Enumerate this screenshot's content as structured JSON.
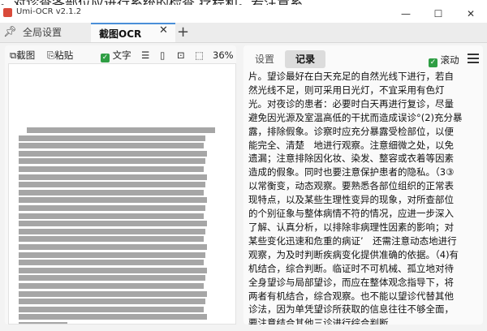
{
  "window": {
    "title": "Umi-OCR v2.1.2",
    "minimize": "—",
    "maximize": "☐",
    "close": "✕"
  },
  "tabs": [
    {
      "label": "全局设置"
    },
    {
      "label": "截图OCR"
    }
  ],
  "tab_close_glyph": "✕",
  "tab_add_glyph": "+",
  "toolbar": {
    "screenshot": "截图",
    "paste": "粘贴",
    "text": "文字",
    "zoom": "36%",
    "icons": [
      "screenshot-icon",
      "paste-icon",
      "text-check-icon",
      "list-icon",
      "file-icon",
      "fit-icon",
      "original-size-icon"
    ]
  },
  "right_tabs": {
    "settings": "设置",
    "record": "记录"
  },
  "scroll_label": "滚动",
  "ocr_lines": [
    "片。望诊最好在白天充足的自然光线下进行，若自",
    "然光线不足，则可采用日光灯，不宜采用有色灯",
    "光。对夜诊的患者：必要时白天再进行复诊，尽量",
    "避免因光源及室温高低的干扰而造成误诊°(2)充分暴",
    "露，排除假象。诊察时应充分暴露受检部位，以便",
    "能完全、清楚　地进行观察。注意细微之处，以免",
    "遗漏；注意排除因化妆、染发、整容或衣着等因素",
    "造成的假象。同时也要注意保护患者的隐私。（3③",
    "以常衡变，动态观察。要熟悉各部位组织的正常表",
    "现特点，以及某些生理性变异的现象，对所查部位",
    "的个别征象与整体病情不符的情况，应进一步深入",
    "了解、认真分析，以排除非病理性因素的影响；对",
    "某些变化迅速和危重的病证’　还需注意动态地进行",
    "观察，为及时判断疾病变化提供准确的依据。（4)有",
    "机结合，综合判断。临证时不可机械、孤立地对待",
    "全身望诊与局部望诊，而应在整体观念指导下，将",
    "两者有机结合，综合观察。也不能以望诊代替其他",
    "诊法，因为单凭望诊所获取的信息往往不够全面，",
    "要注意结合其他三诊进行综合判断"
  ],
  "top_partial_line": "。对诊查各部位应进行系统的检查 疗程和。若注意系"
}
